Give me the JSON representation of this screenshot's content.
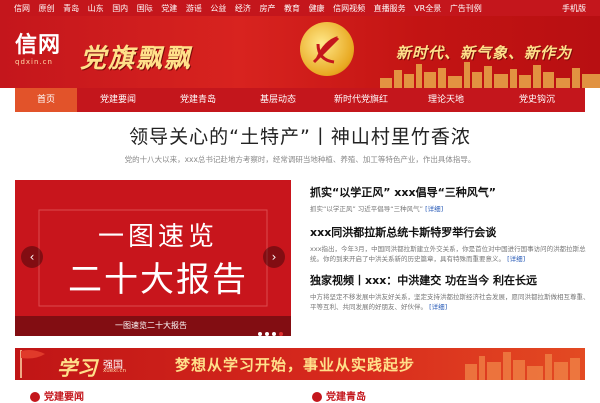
{
  "topbar": {
    "left_items": [
      "信网",
      "原创",
      "青岛",
      "山东",
      "国内",
      "国际",
      "党建",
      "游谣",
      "公益",
      "经济",
      "房产",
      "教育",
      "健康",
      "信网视频",
      "直播服务",
      "VR全景",
      "广告刊例"
    ],
    "right_item": "手机版"
  },
  "banner": {
    "logo_text": "信网",
    "logo_domain": "qdxin.cn",
    "title": "党旗飘飘",
    "slogan": "新时代、新气象、新作为"
  },
  "nav": {
    "items": [
      "首页",
      "党建要闻",
      "党建青岛",
      "基层动态",
      "新时代党旗红",
      "理论天地",
      "党史钩沉"
    ],
    "active_index": 0
  },
  "headline": {
    "title": "领导关心的“土特产”丨神山村里竹香浓",
    "subtitle": "党的十八大以来，xxx总书记赴地方考察时，经常调研当地种植、养殖、加工等特色产业，作出具体指导。"
  },
  "carousel": {
    "big_line1": "一图速览",
    "big_line2": "二十大报告",
    "caption": "一图速览二十大报告",
    "dot_count": 4,
    "active_dot": 3
  },
  "news": [
    {
      "title": "抓实“以学正风” xxx倡导“三种风气”",
      "desc": "抓实“以学正风” 习近平倡导“三种风气”",
      "more": "[详细]"
    },
    {
      "title": "xxx同洪都拉斯总统卡斯特罗举行会谈",
      "desc": "xxx指出，今年3月，中国同洪都拉斯建立外交关系，你是首位对中国进行国事访问的洪都拉斯总统。你的到来开启了中洪关系新的历史篇章，具有特殊而重要意义。",
      "more": "[详细]"
    },
    {
      "title": "独家视频丨xxx：中洪建交 功在当今 利在长远",
      "desc": "中方将坚定不移发展中洪友好关系，坚定支持洪都拉斯经济社会发展，愿同洪都拉斯做相互尊重、平等互利、共同发展的好朋友、好伙伴。",
      "more": "[详细]"
    }
  ],
  "ad": {
    "xuexi": "学习",
    "qiangguo": "强国",
    "domain": "xuexi.cn",
    "slogan": "梦想从学习开始，事业从实践起步"
  },
  "bottom": {
    "left_heading": "党建要闻",
    "right_heading": "党建青岛"
  },
  "colors": {
    "brand_red": "#c4161c",
    "nav_active": "#e2532a",
    "gold": "#ffe08a",
    "link_blue": "#2a5cb8"
  }
}
